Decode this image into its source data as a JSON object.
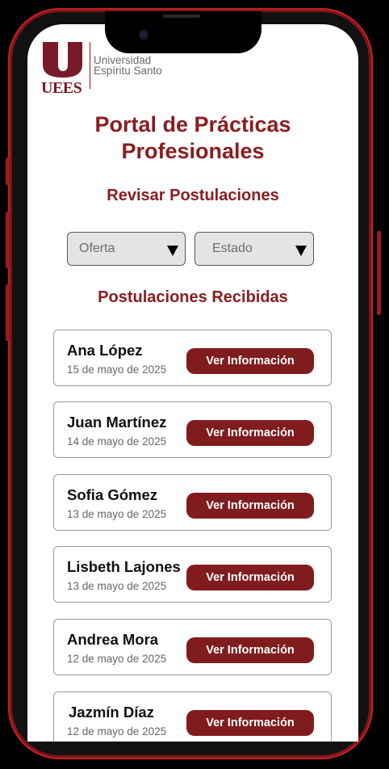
{
  "brand": {
    "logo_text": "UEES",
    "university_line1": "Universidad",
    "university_line2": "Espíritu Santo"
  },
  "page": {
    "title_line1": "Portal de Prácticas",
    "title_line2": "Profesionales",
    "subtitle": "Revisar Postulaciones",
    "section_title": "Postulaciones Recibidas"
  },
  "filters": {
    "offer": {
      "value": "Oferta"
    },
    "status": {
      "value": "Estado"
    }
  },
  "applications": [
    {
      "name": "Ana López",
      "date": "15 de mayo de 2025",
      "action": "Ver Información"
    },
    {
      "name": "Juan Martínez",
      "date": "14 de mayo de 2025",
      "action": "Ver Información"
    },
    {
      "name": "Sofia Gómez",
      "date": "13 de mayo de 2025",
      "action": "Ver Información"
    },
    {
      "name": "Lisbeth Lajones",
      "date": "13 de mayo de 2025",
      "action": "Ver Información"
    },
    {
      "name": "Andrea Mora",
      "date": "12 de mayo de 2025",
      "action": "Ver Información"
    },
    {
      "name": "Jazmín Díaz",
      "date": "12 de mayo de 2025",
      "action": "Ver Información"
    }
  ],
  "colors": {
    "accent": "#8b1c1f",
    "button": "#801c1e",
    "frame": "#c42026"
  }
}
